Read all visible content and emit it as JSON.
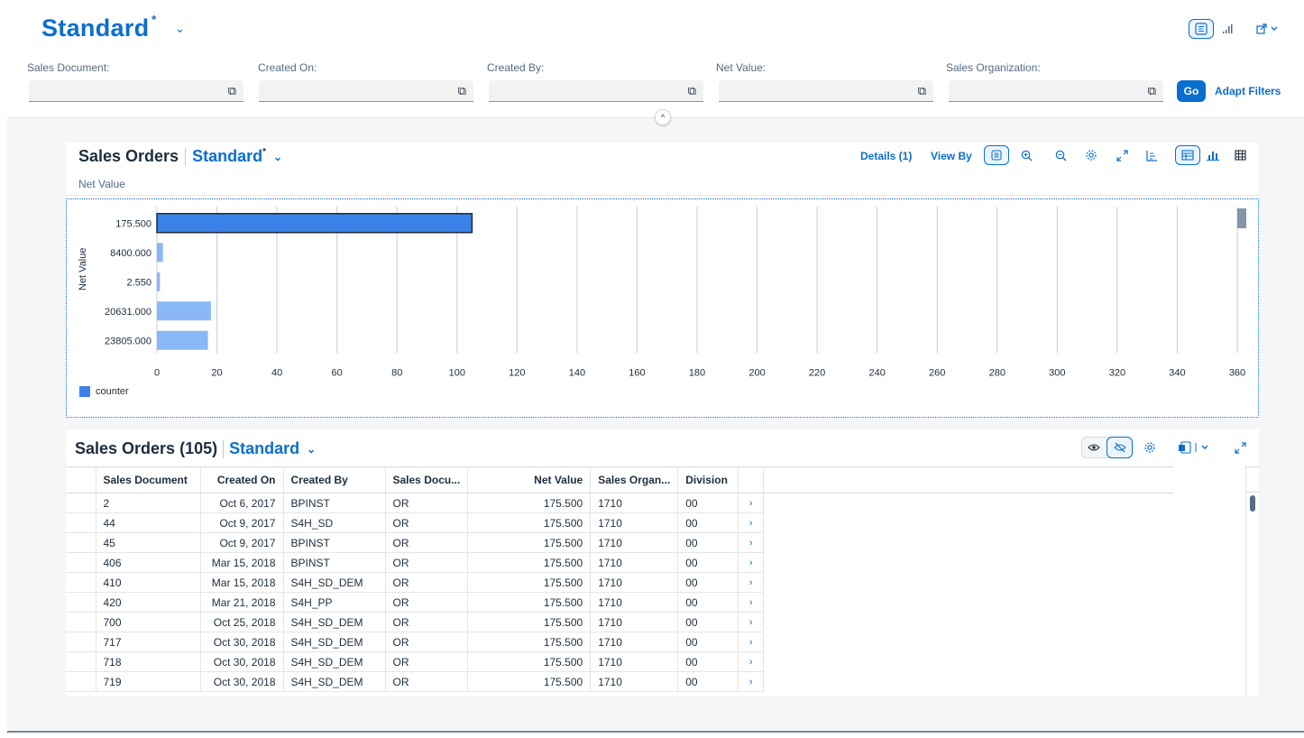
{
  "page": {
    "title": "Standard",
    "title_marker": "*"
  },
  "filters": [
    {
      "label": "Sales Document:",
      "value": ""
    },
    {
      "label": "Created On:",
      "value": ""
    },
    {
      "label": "Created By:",
      "value": ""
    },
    {
      "label": "Net Value:",
      "value": ""
    },
    {
      "label": "Sales Organization:",
      "value": ""
    }
  ],
  "filterbar": {
    "go_label": "Go",
    "adapt_label": "Adapt Filters"
  },
  "chart_card": {
    "title": "Sales Orders",
    "variant": "Standard",
    "variant_marker": "*",
    "subtitle": "Net Value",
    "details_label": "Details (1)",
    "viewby_label": "View By"
  },
  "chart_data": {
    "type": "bar",
    "orientation": "horizontal",
    "categories": [
      "175.500",
      "8400.000",
      "2.550",
      "20631.000",
      "23805.000"
    ],
    "series": [
      {
        "name": "counter",
        "values": [
          105,
          2,
          1,
          18,
          17
        ]
      }
    ],
    "selected_index": 0,
    "ylabel": "Net Value",
    "xlim": [
      0,
      360
    ],
    "xticks": [
      0,
      20,
      40,
      60,
      80,
      100,
      120,
      140,
      160,
      180,
      200,
      220,
      240,
      260,
      280,
      300,
      320,
      340,
      360
    ],
    "grid": true,
    "legend": "bottom-left",
    "colors": {
      "bar": "#89b7f7",
      "selected": "#3b82e8",
      "grid": "#c7cfd6"
    }
  },
  "table_card": {
    "title": "Sales Orders (105)",
    "variant": "Standard",
    "columns": [
      "Sales Document",
      "Created On",
      "Created By",
      "Sales Docu...",
      "Net Value",
      "Sales Organ...",
      "Division"
    ],
    "rows": [
      [
        "2",
        "Oct 6, 2017",
        "BPINST",
        "OR",
        "175.500",
        "1710",
        "00"
      ],
      [
        "44",
        "Oct 9, 2017",
        "S4H_SD",
        "OR",
        "175.500",
        "1710",
        "00"
      ],
      [
        "45",
        "Oct 9, 2017",
        "BPINST",
        "OR",
        "175.500",
        "1710",
        "00"
      ],
      [
        "406",
        "Mar 15, 2018",
        "BPINST",
        "OR",
        "175.500",
        "1710",
        "00"
      ],
      [
        "410",
        "Mar 15, 2018",
        "S4H_SD_DEM",
        "OR",
        "175.500",
        "1710",
        "00"
      ],
      [
        "420",
        "Mar 21, 2018",
        "S4H_PP",
        "OR",
        "175.500",
        "1710",
        "00"
      ],
      [
        "700",
        "Oct 25, 2018",
        "S4H_SD_DEM",
        "OR",
        "175.500",
        "1710",
        "00"
      ],
      [
        "717",
        "Oct 30, 2018",
        "S4H_SD_DEM",
        "OR",
        "175.500",
        "1710",
        "00"
      ],
      [
        "718",
        "Oct 30, 2018",
        "S4H_SD_DEM",
        "OR",
        "175.500",
        "1710",
        "00"
      ],
      [
        "719",
        "Oct 30, 2018",
        "S4H_SD_DEM",
        "OR",
        "175.500",
        "1710",
        "00"
      ]
    ],
    "row_nav_icon": "›"
  },
  "colors": {
    "accent": "#0a6ed1",
    "text": "#1d2d3e",
    "label": "#556b82",
    "background": "#f5f6f7"
  },
  "icons": {
    "header": [
      "layout-list-icon",
      "chart-bars-icon",
      "share-icon"
    ],
    "chart_toolbar": [
      "legend-icon",
      "zoom-in-icon",
      "zoom-out-icon",
      "settings-icon",
      "fullscreen-icon",
      "axis-icon",
      "chart-table-icon",
      "bar-chart-icon",
      "table-grid-icon"
    ],
    "table_toolbar": [
      "show-details-icon",
      "hide-details-icon",
      "settings-icon",
      "export-icon",
      "fullscreen-icon"
    ]
  }
}
